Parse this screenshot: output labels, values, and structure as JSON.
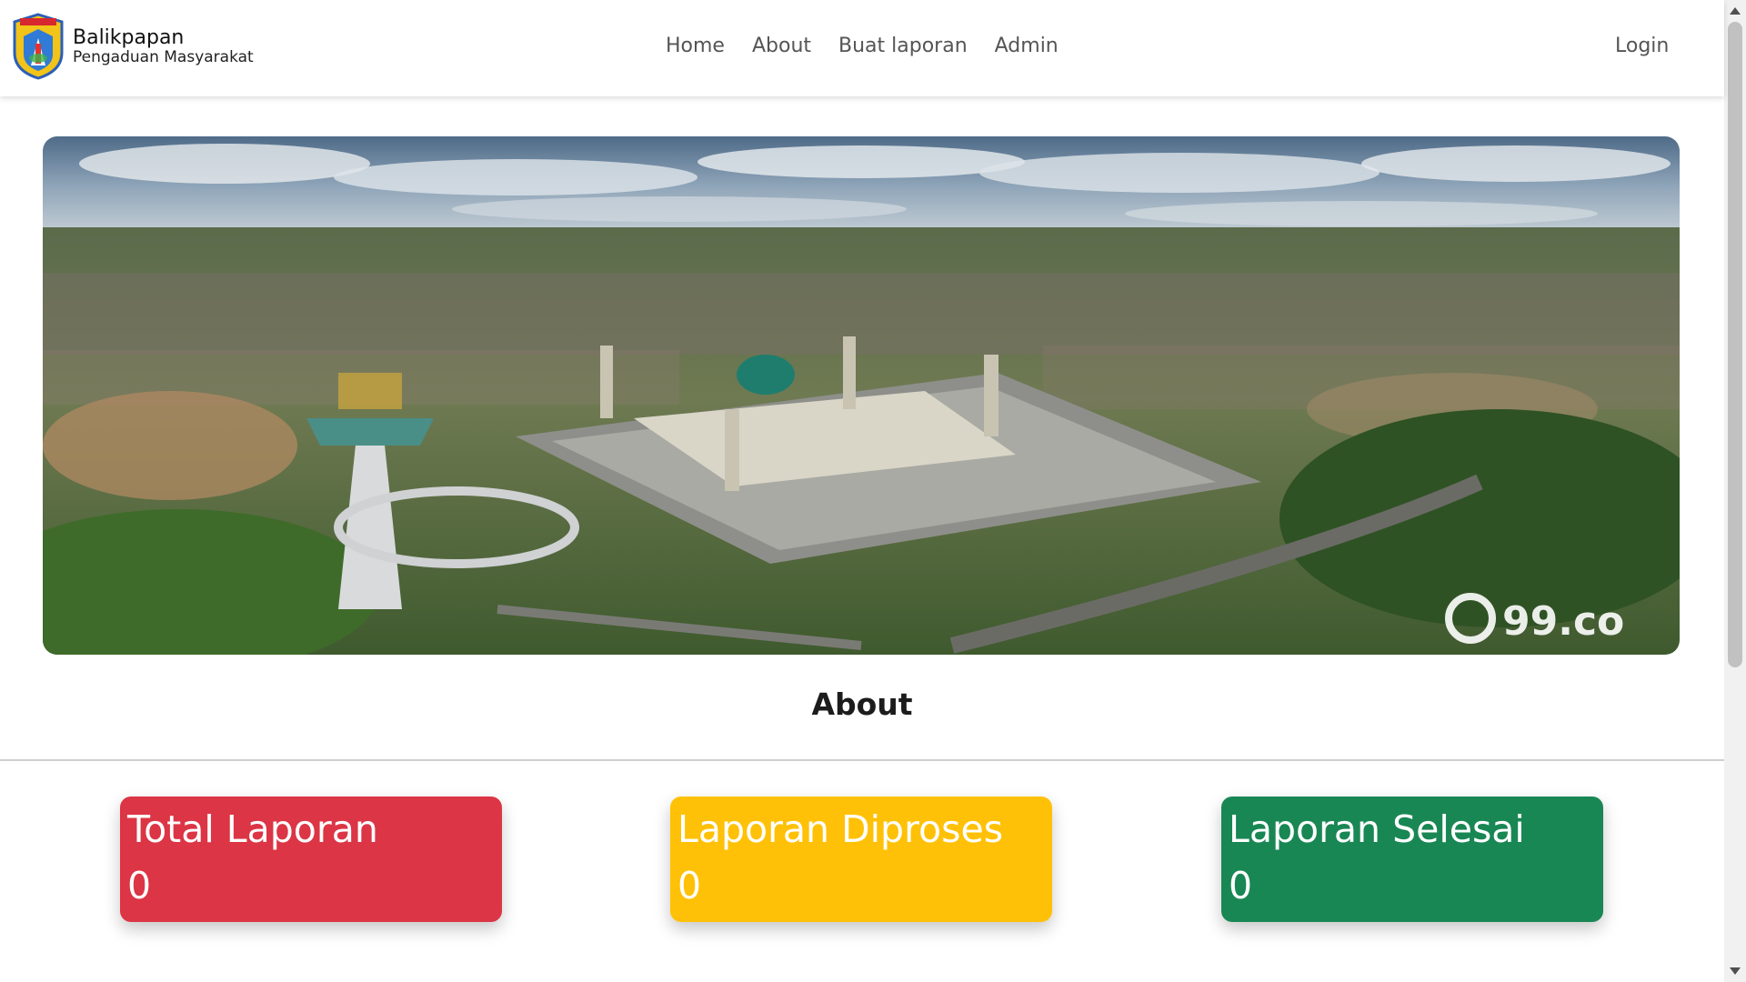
{
  "navbar": {
    "brand_title": "Balikpapan",
    "brand_subtitle": "Pengaduan Masyarakat",
    "logo_icon": "city-crest-logo",
    "links": [
      "Home",
      "About",
      "Buat laporan",
      "Admin"
    ],
    "login_label": "Login"
  },
  "hero": {
    "image_description_icon": "aerial-mosque-photo",
    "watermark": "99.co"
  },
  "about": {
    "title": "About"
  },
  "stats": [
    {
      "label": "Total Laporan",
      "value": "0",
      "color": "#dc3545"
    },
    {
      "label": "Laporan Diproses",
      "value": "0",
      "color": "#ffc107"
    },
    {
      "label": "Laporan Selesai",
      "value": "0",
      "color": "#198754"
    }
  ]
}
